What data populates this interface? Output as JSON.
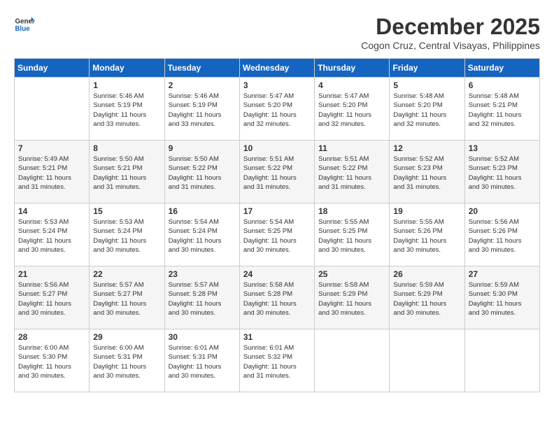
{
  "header": {
    "logo_line1": "General",
    "logo_line2": "Blue",
    "month": "December 2025",
    "location": "Cogon Cruz, Central Visayas, Philippines"
  },
  "weekdays": [
    "Sunday",
    "Monday",
    "Tuesday",
    "Wednesday",
    "Thursday",
    "Friday",
    "Saturday"
  ],
  "weeks": [
    [
      {
        "day": "",
        "info": ""
      },
      {
        "day": "1",
        "info": "Sunrise: 5:46 AM\nSunset: 5:19 PM\nDaylight: 11 hours\nand 33 minutes."
      },
      {
        "day": "2",
        "info": "Sunrise: 5:46 AM\nSunset: 5:19 PM\nDaylight: 11 hours\nand 33 minutes."
      },
      {
        "day": "3",
        "info": "Sunrise: 5:47 AM\nSunset: 5:20 PM\nDaylight: 11 hours\nand 32 minutes."
      },
      {
        "day": "4",
        "info": "Sunrise: 5:47 AM\nSunset: 5:20 PM\nDaylight: 11 hours\nand 32 minutes."
      },
      {
        "day": "5",
        "info": "Sunrise: 5:48 AM\nSunset: 5:20 PM\nDaylight: 11 hours\nand 32 minutes."
      },
      {
        "day": "6",
        "info": "Sunrise: 5:48 AM\nSunset: 5:21 PM\nDaylight: 11 hours\nand 32 minutes."
      }
    ],
    [
      {
        "day": "7",
        "info": "Sunrise: 5:49 AM\nSunset: 5:21 PM\nDaylight: 11 hours\nand 31 minutes."
      },
      {
        "day": "8",
        "info": "Sunrise: 5:50 AM\nSunset: 5:21 PM\nDaylight: 11 hours\nand 31 minutes."
      },
      {
        "day": "9",
        "info": "Sunrise: 5:50 AM\nSunset: 5:22 PM\nDaylight: 11 hours\nand 31 minutes."
      },
      {
        "day": "10",
        "info": "Sunrise: 5:51 AM\nSunset: 5:22 PM\nDaylight: 11 hours\nand 31 minutes."
      },
      {
        "day": "11",
        "info": "Sunrise: 5:51 AM\nSunset: 5:22 PM\nDaylight: 11 hours\nand 31 minutes."
      },
      {
        "day": "12",
        "info": "Sunrise: 5:52 AM\nSunset: 5:23 PM\nDaylight: 11 hours\nand 31 minutes."
      },
      {
        "day": "13",
        "info": "Sunrise: 5:52 AM\nSunset: 5:23 PM\nDaylight: 11 hours\nand 30 minutes."
      }
    ],
    [
      {
        "day": "14",
        "info": "Sunrise: 5:53 AM\nSunset: 5:24 PM\nDaylight: 11 hours\nand 30 minutes."
      },
      {
        "day": "15",
        "info": "Sunrise: 5:53 AM\nSunset: 5:24 PM\nDaylight: 11 hours\nand 30 minutes."
      },
      {
        "day": "16",
        "info": "Sunrise: 5:54 AM\nSunset: 5:24 PM\nDaylight: 11 hours\nand 30 minutes."
      },
      {
        "day": "17",
        "info": "Sunrise: 5:54 AM\nSunset: 5:25 PM\nDaylight: 11 hours\nand 30 minutes."
      },
      {
        "day": "18",
        "info": "Sunrise: 5:55 AM\nSunset: 5:25 PM\nDaylight: 11 hours\nand 30 minutes."
      },
      {
        "day": "19",
        "info": "Sunrise: 5:55 AM\nSunset: 5:26 PM\nDaylight: 11 hours\nand 30 minutes."
      },
      {
        "day": "20",
        "info": "Sunrise: 5:56 AM\nSunset: 5:26 PM\nDaylight: 11 hours\nand 30 minutes."
      }
    ],
    [
      {
        "day": "21",
        "info": "Sunrise: 5:56 AM\nSunset: 5:27 PM\nDaylight: 11 hours\nand 30 minutes."
      },
      {
        "day": "22",
        "info": "Sunrise: 5:57 AM\nSunset: 5:27 PM\nDaylight: 11 hours\nand 30 minutes."
      },
      {
        "day": "23",
        "info": "Sunrise: 5:57 AM\nSunset: 5:28 PM\nDaylight: 11 hours\nand 30 minutes."
      },
      {
        "day": "24",
        "info": "Sunrise: 5:58 AM\nSunset: 5:28 PM\nDaylight: 11 hours\nand 30 minutes."
      },
      {
        "day": "25",
        "info": "Sunrise: 5:58 AM\nSunset: 5:29 PM\nDaylight: 11 hours\nand 30 minutes."
      },
      {
        "day": "26",
        "info": "Sunrise: 5:59 AM\nSunset: 5:29 PM\nDaylight: 11 hours\nand 30 minutes."
      },
      {
        "day": "27",
        "info": "Sunrise: 5:59 AM\nSunset: 5:30 PM\nDaylight: 11 hours\nand 30 minutes."
      }
    ],
    [
      {
        "day": "28",
        "info": "Sunrise: 6:00 AM\nSunset: 5:30 PM\nDaylight: 11 hours\nand 30 minutes."
      },
      {
        "day": "29",
        "info": "Sunrise: 6:00 AM\nSunset: 5:31 PM\nDaylight: 11 hours\nand 30 minutes."
      },
      {
        "day": "30",
        "info": "Sunrise: 6:01 AM\nSunset: 5:31 PM\nDaylight: 11 hours\nand 30 minutes."
      },
      {
        "day": "31",
        "info": "Sunrise: 6:01 AM\nSunset: 5:32 PM\nDaylight: 11 hours\nand 31 minutes."
      },
      {
        "day": "",
        "info": ""
      },
      {
        "day": "",
        "info": ""
      },
      {
        "day": "",
        "info": ""
      }
    ]
  ]
}
